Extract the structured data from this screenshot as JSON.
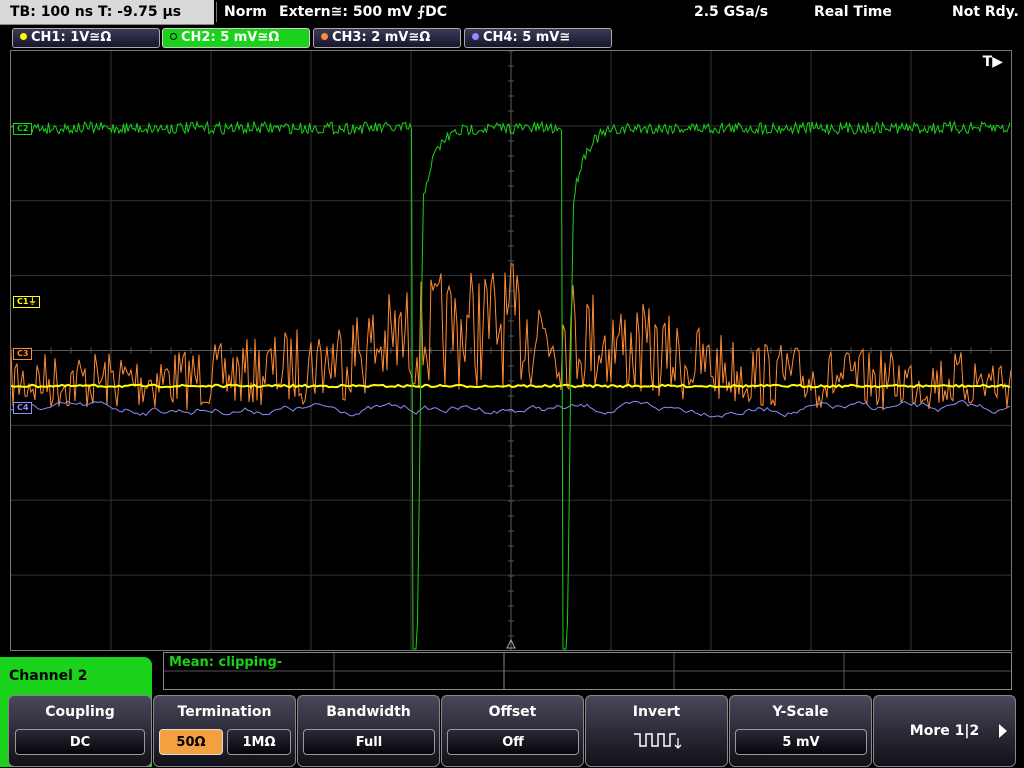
{
  "top_bar": {
    "timebase": "TB: 100 ns   T: -9.75 µs",
    "trigger_mode": "Norm",
    "trigger_source": "Extern≅: 500 mV ⨍DC",
    "sample_rate": "2.5 GSa/s",
    "acquisition": "Real Time",
    "status": "Not Rdy."
  },
  "channels": [
    {
      "label": "CH1: 1V≅Ω",
      "color": "#ffff00"
    },
    {
      "label": "CH2: 5 mV≅Ω",
      "color": "#19d219"
    },
    {
      "label": "CH3: 2 mV≅Ω",
      "color": "#ff8c33"
    },
    {
      "label": "CH4: 5 mV≅",
      "color": "#8c8cff"
    }
  ],
  "plot": {
    "trigger_marker": "T▶",
    "markers": {
      "c1": "C1⏚",
      "c2": "C2",
      "c3": "C3",
      "c4": "C4"
    }
  },
  "measurement": {
    "text": "Mean: clipping-"
  },
  "menu": {
    "title": "Channel 2",
    "coupling": {
      "title": "Coupling",
      "value": "DC"
    },
    "termination": {
      "title": "Termination",
      "opt1": "50Ω",
      "opt2": "1MΩ"
    },
    "bandwidth": {
      "title": "Bandwidth",
      "value": "Full"
    },
    "offset": {
      "title": "Offset",
      "value": "Off"
    },
    "invert": {
      "title": "Invert",
      "icon": "invert-square-wave-icon"
    },
    "yscale": {
      "title": "Y-Scale",
      "value": "5 mV"
    },
    "more": {
      "label": "More 1|2"
    }
  }
}
